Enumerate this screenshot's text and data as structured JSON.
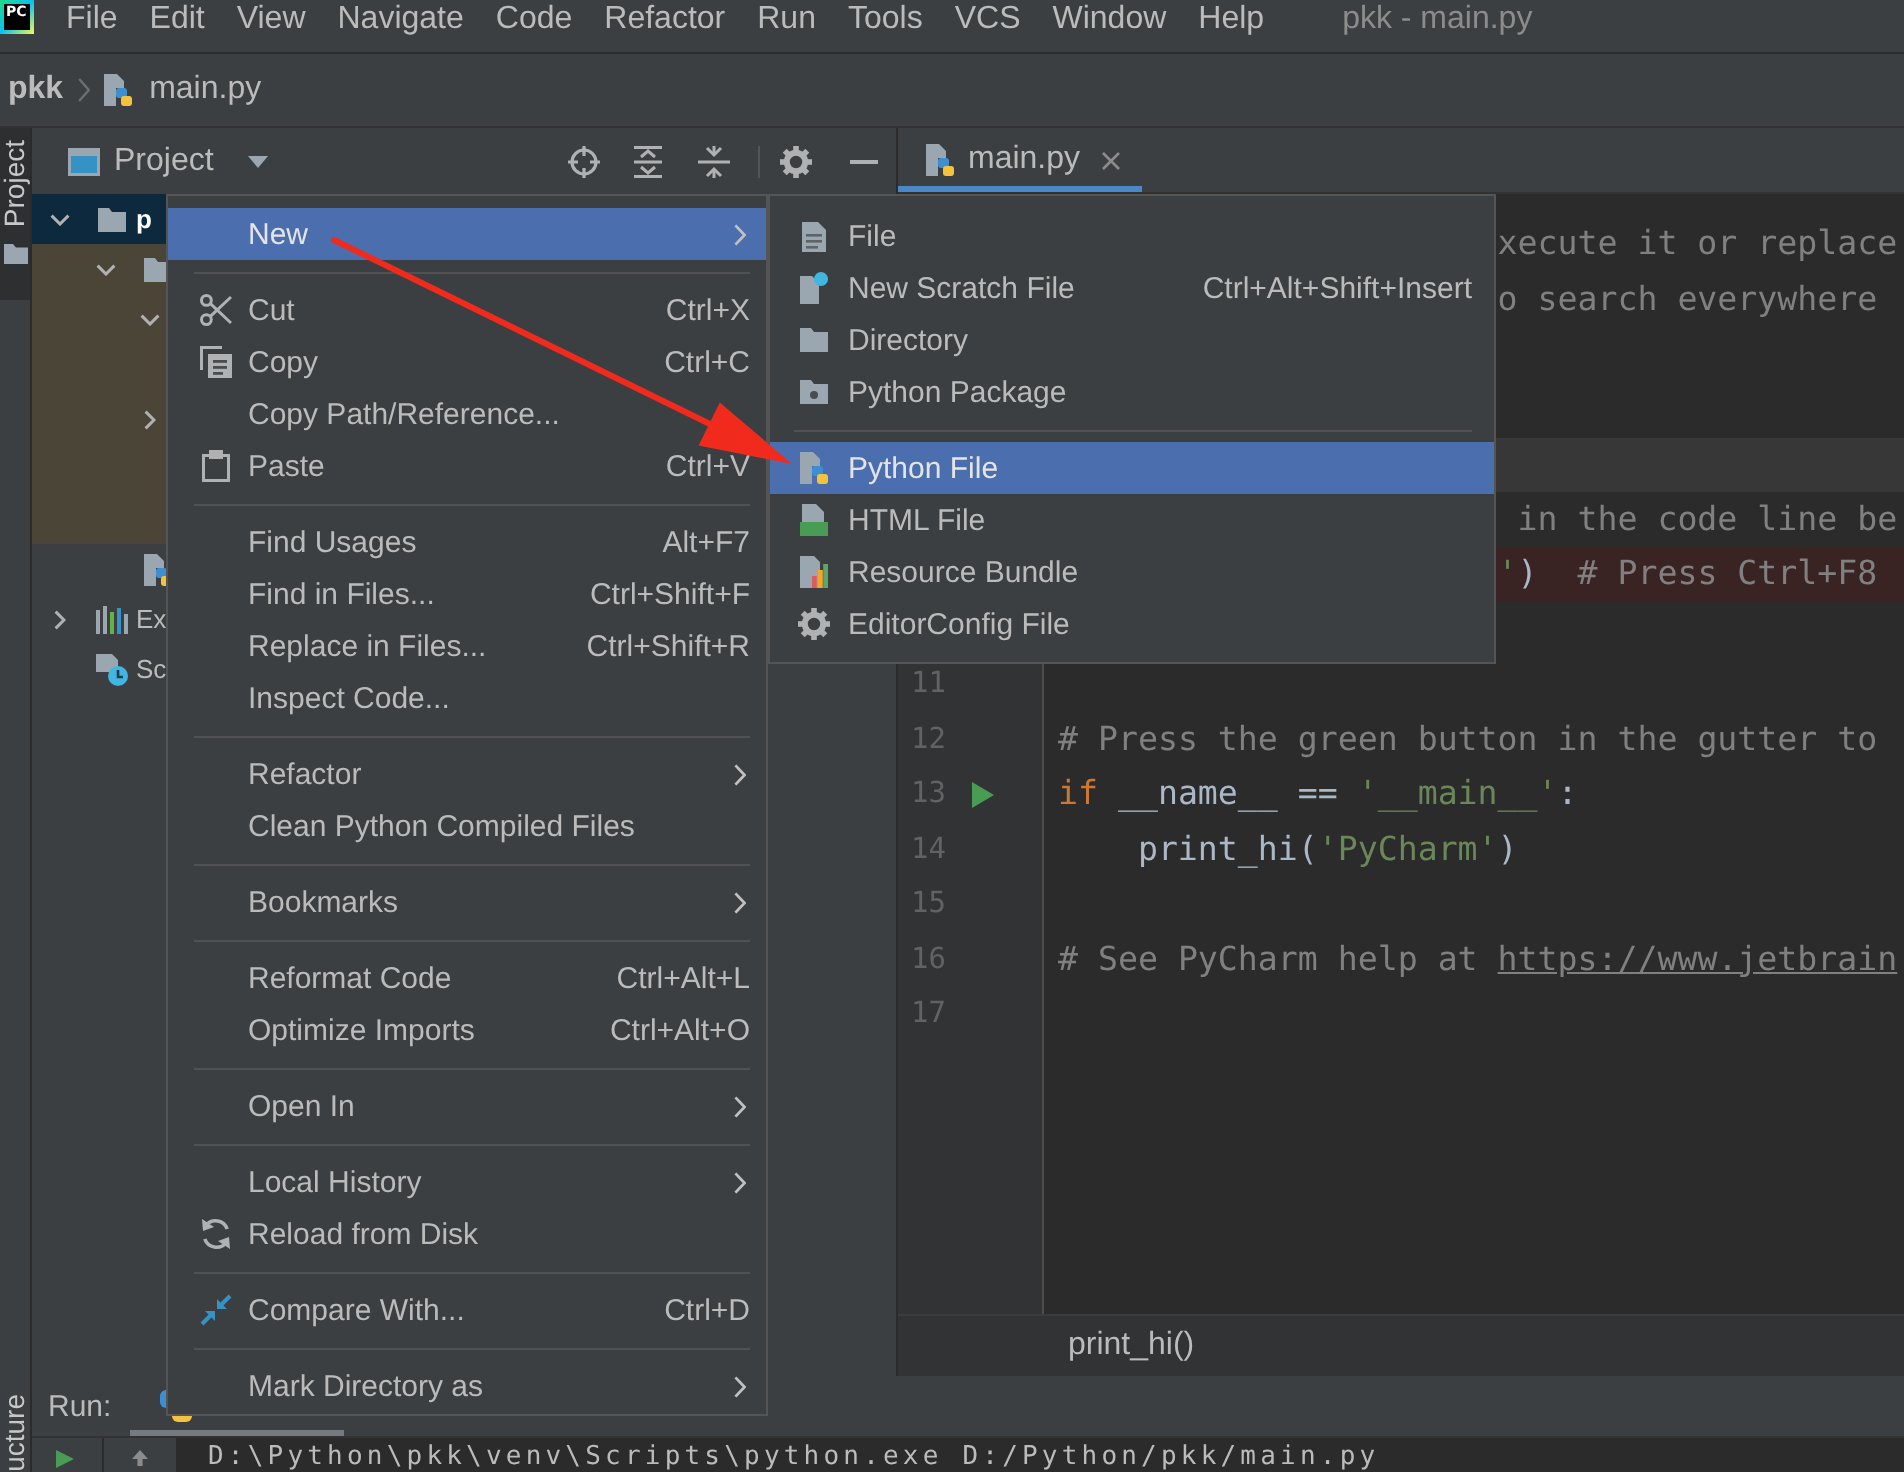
{
  "app": {
    "logo_text": "PC",
    "window_title": "pkk - main.py"
  },
  "menu_bar": [
    {
      "label": "File"
    },
    {
      "label": "Edit"
    },
    {
      "label": "View"
    },
    {
      "label": "Navigate"
    },
    {
      "label": "Code"
    },
    {
      "label": "Refactor"
    },
    {
      "label": "Run"
    },
    {
      "label": "Tools"
    },
    {
      "label": "VCS"
    },
    {
      "label": "Window"
    },
    {
      "label": "Help"
    }
  ],
  "navigation_bar": {
    "project": "pkk",
    "file": "main.py"
  },
  "tool_stripe": [
    {
      "label": "Project",
      "selected": true
    },
    {
      "label": "ucture",
      "selected": false
    }
  ],
  "project_panel": {
    "title": "Project",
    "tree": [
      {
        "kind": "folder",
        "label": "p",
        "selected": true,
        "expanded": true,
        "highlighted": false,
        "children": [
          {
            "kind": "folder",
            "selected": false,
            "expanded": true,
            "highlighted": true,
            "children": [
              {
                "selected": false,
                "expanded": true,
                "children": [
                  {
                    "selected": false
                  }
                ]
              },
              {
                "selected": false,
                "expanded": false
              },
              {
                "selected": false
              },
              {
                "selected": false
              }
            ]
          },
          {
            "kind": "python_file",
            "selected": false,
            "highlighted": false
          }
        ]
      },
      {
        "kind": "libraries",
        "label": "Ex",
        "selected": false,
        "expanded": false,
        "highlighted": false
      },
      {
        "kind": "scratches",
        "label": "Sc",
        "selected": false,
        "highlighted": false
      }
    ]
  },
  "editor": {
    "tabs": [
      {
        "label": "main.py",
        "selected": true
      }
    ],
    "lines": [
      {
        "covered": true,
        "current": false,
        "breakpoint": false,
        "segments": [
          {
            "kind": "comment",
            "text": "xecute it or replace"
          }
        ]
      },
      {
        "covered": true,
        "current": false,
        "breakpoint": false,
        "segments": [
          {
            "kind": "comment",
            "text": "o search everywhere"
          }
        ]
      },
      {
        "current": false,
        "breakpoint": false
      },
      {
        "current": false,
        "breakpoint": false
      },
      {
        "current": true,
        "breakpoint": false
      },
      {
        "covered": true,
        "current": false,
        "breakpoint": false,
        "segments": [
          {
            "kind": "comment",
            "text": " in the code line be"
          }
        ]
      },
      {
        "covered": true,
        "current": false,
        "breakpoint": true,
        "segments": [
          {
            "kind": "string",
            "text": "'"
          },
          {
            "kind": "plain",
            "text": ")"
          },
          {
            "kind": "comment",
            "text": "  # Press Ctrl+F8"
          }
        ]
      },
      {
        "current": false,
        "breakpoint": false
      },
      {
        "number": "11",
        "run_marker": false,
        "current": false,
        "breakpoint": false
      },
      {
        "number": "12",
        "run_marker": false,
        "current": false,
        "breakpoint": false,
        "covered": false,
        "segments": [
          {
            "kind": "comment",
            "text": "# Press the green button in the gutter to"
          }
        ]
      },
      {
        "number": "13",
        "run_marker": true,
        "current": false,
        "breakpoint": false,
        "covered": false,
        "segments": [
          {
            "kind": "keyword",
            "text": "if"
          },
          {
            "kind": "plain",
            "text": " __name__ == "
          },
          {
            "kind": "string",
            "text": "'__main__'"
          },
          {
            "kind": "plain",
            "text": ":"
          }
        ]
      },
      {
        "number": "14",
        "run_marker": false,
        "current": false,
        "breakpoint": false,
        "covered": false,
        "segments": [
          {
            "kind": "plain",
            "text": "    print_hi("
          },
          {
            "kind": "string",
            "text": "'PyCharm'"
          },
          {
            "kind": "plain",
            "text": ")"
          }
        ]
      },
      {
        "number": "15",
        "run_marker": false,
        "current": false,
        "breakpoint": false
      },
      {
        "number": "16",
        "run_marker": false,
        "current": false,
        "breakpoint": false,
        "covered": false,
        "segments": [
          {
            "kind": "comment",
            "text": "# See PyCharm help at "
          },
          {
            "kind": "link",
            "text": "https://www.jetbrain"
          }
        ]
      },
      {
        "number": "17",
        "run_marker": false,
        "current": false,
        "breakpoint": false
      }
    ],
    "breadcrumb": "print_hi()"
  },
  "run_panel": {
    "title": "Run:",
    "console": "D:\\Python\\pkk\\venv\\Scripts\\python.exe D:/Python/pkk/main.py"
  },
  "context_menu": {
    "items": [
      {
        "kind": "item",
        "label": "New",
        "selected": true,
        "submenu": true
      },
      {
        "kind": "separator"
      },
      {
        "kind": "item",
        "label": "Cut",
        "shortcut": "Ctrl+X",
        "selected": false,
        "submenu": false
      },
      {
        "kind": "item",
        "label": "Copy",
        "shortcut": "Ctrl+C",
        "selected": false,
        "submenu": false
      },
      {
        "kind": "item",
        "label": "Copy Path/Reference...",
        "selected": false,
        "submenu": false
      },
      {
        "kind": "item",
        "label": "Paste",
        "shortcut": "Ctrl+V",
        "selected": false,
        "submenu": false
      },
      {
        "kind": "separator"
      },
      {
        "kind": "item",
        "label": "Find Usages",
        "shortcut": "Alt+F7",
        "selected": false,
        "submenu": false
      },
      {
        "kind": "item",
        "label": "Find in Files...",
        "shortcut": "Ctrl+Shift+F",
        "selected": false,
        "submenu": false
      },
      {
        "kind": "item",
        "label": "Replace in Files...",
        "shortcut": "Ctrl+Shift+R",
        "selected": false,
        "submenu": false
      },
      {
        "kind": "item",
        "label": "Inspect Code...",
        "selected": false,
        "submenu": false
      },
      {
        "kind": "separator"
      },
      {
        "kind": "item",
        "label": "Refactor",
        "selected": false,
        "submenu": true
      },
      {
        "kind": "item",
        "label": "Clean Python Compiled Files",
        "selected": false,
        "submenu": false
      },
      {
        "kind": "separator"
      },
      {
        "kind": "item",
        "label": "Bookmarks",
        "selected": false,
        "submenu": true
      },
      {
        "kind": "separator"
      },
      {
        "kind": "item",
        "label": "Reformat Code",
        "shortcut": "Ctrl+Alt+L",
        "selected": false,
        "submenu": false
      },
      {
        "kind": "item",
        "label": "Optimize Imports",
        "shortcut": "Ctrl+Alt+O",
        "selected": false,
        "submenu": false
      },
      {
        "kind": "separator"
      },
      {
        "kind": "item",
        "label": "Open In",
        "selected": false,
        "submenu": true
      },
      {
        "kind": "separator"
      },
      {
        "kind": "item",
        "label": "Local History",
        "selected": false,
        "submenu": true
      },
      {
        "kind": "item",
        "label": "Reload from Disk",
        "selected": false,
        "submenu": false
      },
      {
        "kind": "separator"
      },
      {
        "kind": "item",
        "label": "Compare With...",
        "shortcut": "Ctrl+D",
        "selected": false,
        "submenu": false
      },
      {
        "kind": "separator"
      },
      {
        "kind": "item",
        "label": "Mark Directory as",
        "selected": false,
        "submenu": true
      }
    ]
  },
  "new_submenu": {
    "items": [
      {
        "kind": "item",
        "label": "File",
        "selected": false,
        "submenu": false
      },
      {
        "kind": "item",
        "label": "New Scratch File",
        "shortcut": "Ctrl+Alt+Shift+Insert",
        "selected": false,
        "submenu": false
      },
      {
        "kind": "item",
        "label": "Directory",
        "selected": false,
        "submenu": false
      },
      {
        "kind": "item",
        "label": "Python Package",
        "selected": false,
        "submenu": false
      },
      {
        "kind": "separator"
      },
      {
        "kind": "item",
        "label": "Python File",
        "selected": true,
        "submenu": false
      },
      {
        "kind": "item",
        "label": "HTML File",
        "selected": false,
        "submenu": false
      },
      {
        "kind": "item",
        "label": "Resource Bundle",
        "selected": false,
        "submenu": false
      },
      {
        "kind": "item",
        "label": "EditorConfig File",
        "selected": false,
        "submenu": false
      }
    ]
  }
}
